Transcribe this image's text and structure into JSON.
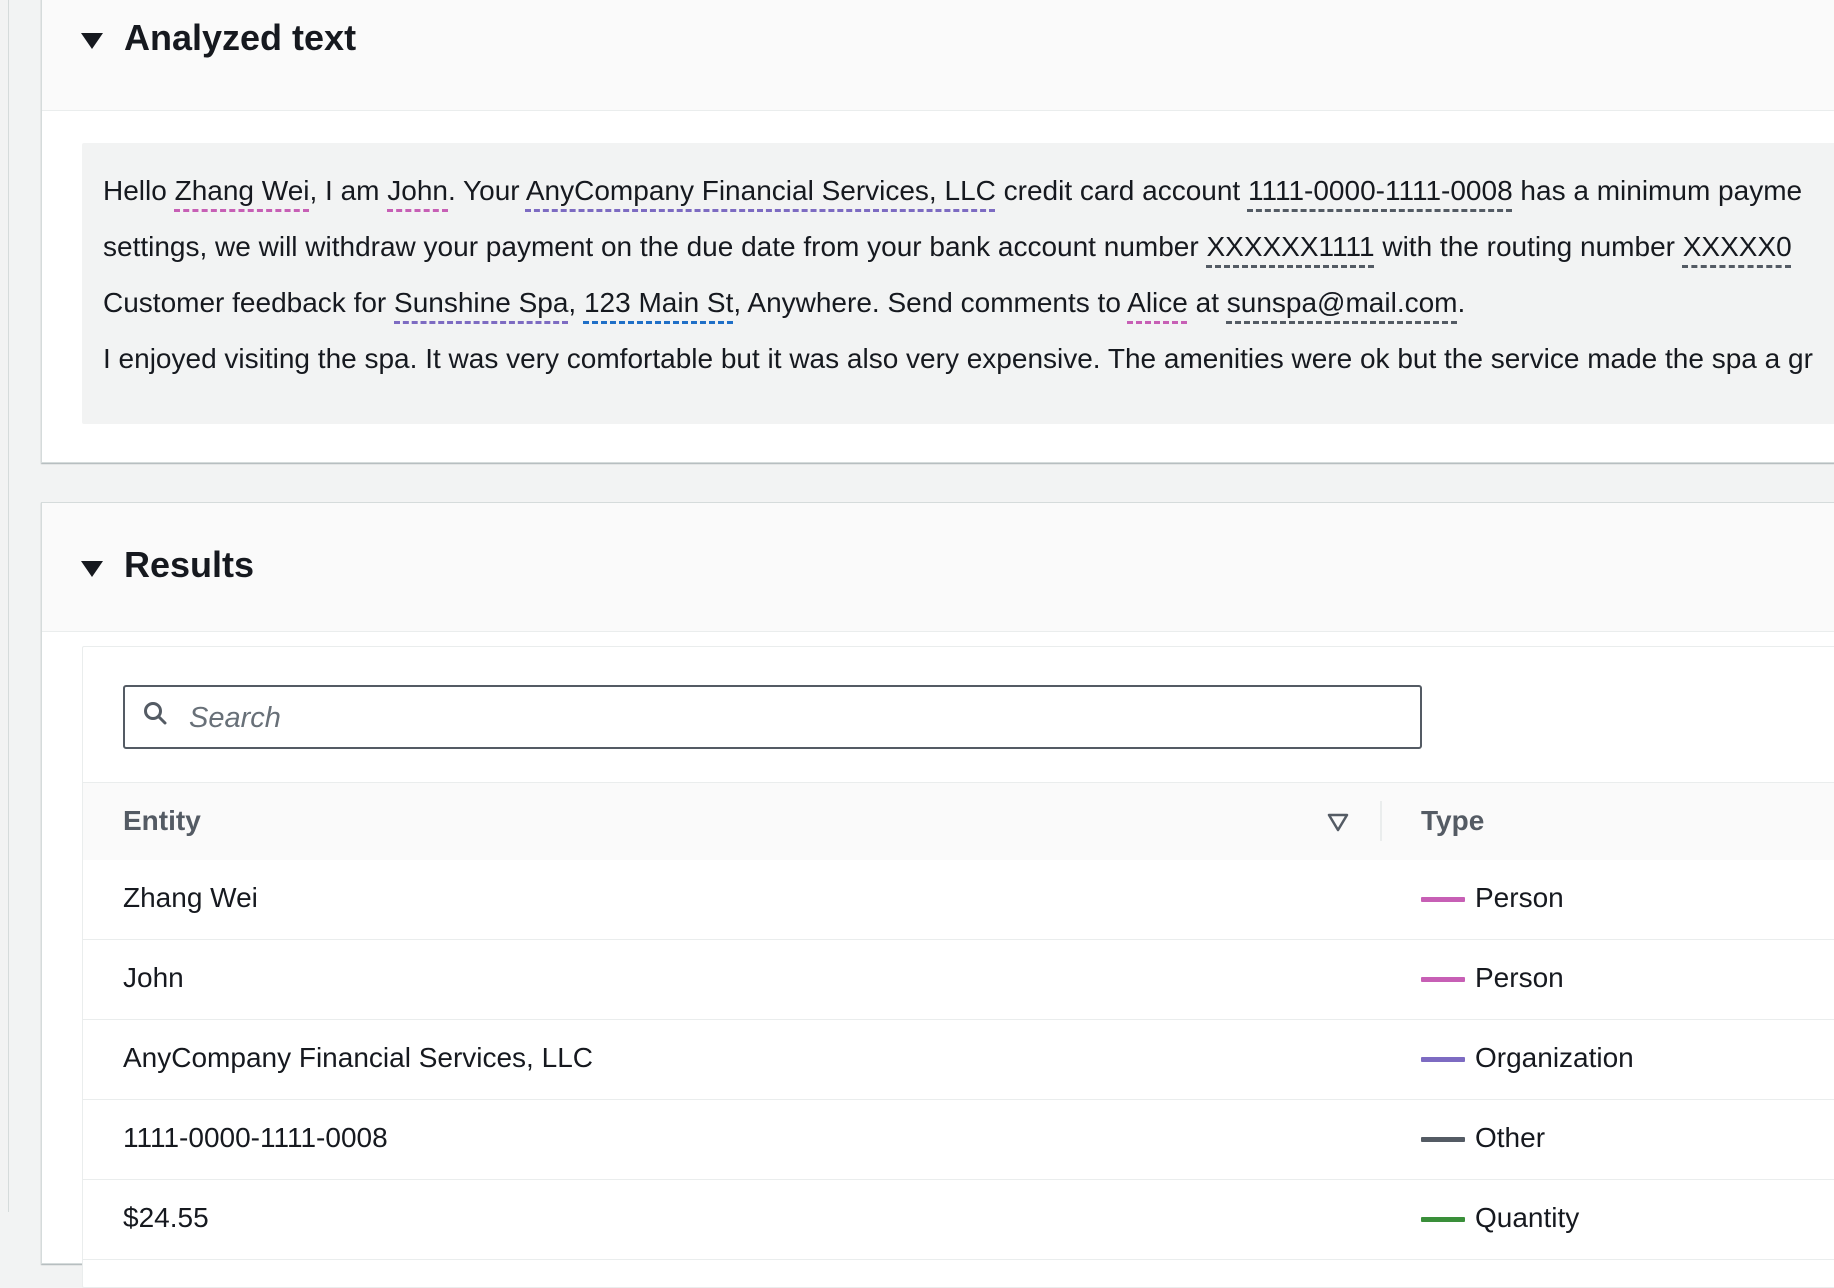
{
  "analyzed_panel": {
    "title": "Analyzed text",
    "lines": [
      [
        {
          "text": "Hello "
        },
        {
          "text": "Zhang Wei",
          "type": "person"
        },
        {
          "text": ", I am "
        },
        {
          "text": "John",
          "type": "person"
        },
        {
          "text": ". Your "
        },
        {
          "text": "AnyCompany Financial Services, LLC",
          "type": "org"
        },
        {
          "text": " credit card account "
        },
        {
          "text": "1111-0000-1111-0008",
          "type": "other"
        },
        {
          "text": " has a minimum payme"
        }
      ],
      [
        {
          "text": "settings, we will withdraw your payment on the due date from your bank account number "
        },
        {
          "text": "XXXXXX1111",
          "type": "other"
        },
        {
          "text": " with the routing number "
        },
        {
          "text": "XXXXX0",
          "type": "other"
        }
      ],
      [
        {
          "text": "Customer feedback for "
        },
        {
          "text": "Sunshine Spa",
          "type": "org"
        },
        {
          "text": ", "
        },
        {
          "text": "123 Main St",
          "type": "addr"
        },
        {
          "text": ", Anywhere. Send comments to "
        },
        {
          "text": "Alice",
          "type": "person"
        },
        {
          "text": " at "
        },
        {
          "text": "sunspa@mail.com",
          "type": "other"
        },
        {
          "text": "."
        }
      ],
      [
        {
          "text": "I enjoyed visiting the spa. It was very comfortable but it was also very expensive. The amenities were ok but the service made the spa a gr"
        }
      ]
    ]
  },
  "results_panel": {
    "title": "Results",
    "search": {
      "placeholder": "Search",
      "value": ""
    },
    "columns": {
      "entity": "Entity",
      "type": "Type"
    },
    "rows": [
      {
        "entity": "Zhang Wei",
        "type": "Person",
        "color": "#c75fb5"
      },
      {
        "entity": "John",
        "type": "Person",
        "color": "#c75fb5"
      },
      {
        "entity": "AnyCompany Financial Services, LLC",
        "type": "Organization",
        "color": "#7d6bc2"
      },
      {
        "entity": "1111-0000-1111-0008",
        "type": "Other",
        "color": "#545b64"
      },
      {
        "entity": "$24.55",
        "type": "Quantity",
        "color": "#3a8f3a"
      }
    ]
  },
  "icons": {
    "expand": "caret-down-icon",
    "search": "search-icon",
    "sort": "sort-descending-icon"
  }
}
